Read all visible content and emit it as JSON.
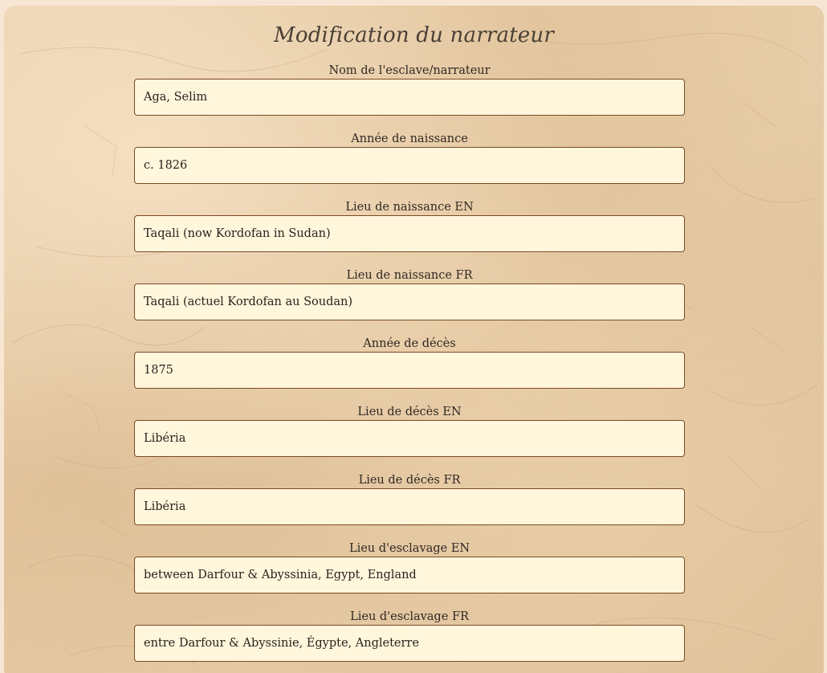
{
  "page": {
    "title": "Modification du narrateur"
  },
  "form": {
    "fields": [
      {
        "label": "Nom de l'esclave/narrateur",
        "value": "Aga, Selim"
      },
      {
        "label": "Année de naissance",
        "value": "c. 1826"
      },
      {
        "label": "Lieu de naissance EN",
        "value": "Taqali (now Kordofan in Sudan)"
      },
      {
        "label": "Lieu de naissance FR",
        "value": "Taqali (actuel Kordofan au Soudan)"
      },
      {
        "label": "Année de décès",
        "value": "1875"
      },
      {
        "label": "Lieu de décès EN",
        "value": "Libéria"
      },
      {
        "label": "Lieu de décès FR",
        "value": "Libéria"
      },
      {
        "label": "Lieu d'esclavage EN",
        "value": "between Darfour & Abyssinia, Egypt, England"
      },
      {
        "label": "Lieu d'esclavage FR",
        "value": "entre Darfour & Abyssinie, Égypte, Angleterre"
      }
    ]
  },
  "colors": {
    "page_background": "#f7e6d3",
    "parchment": "#e6cba6",
    "input_background": "#fff6dc",
    "input_border": "#7a4a22",
    "text": "#2a221c"
  }
}
